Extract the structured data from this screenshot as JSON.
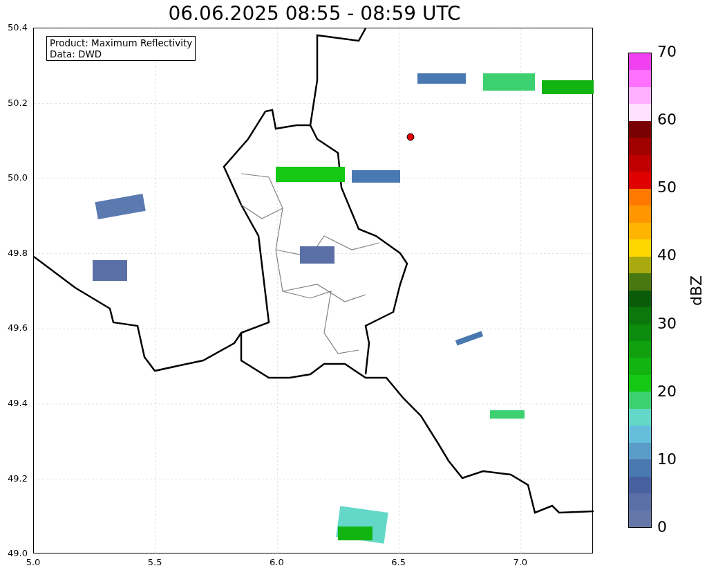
{
  "title": "06.06.2025 08:55 - 08:59 UTC",
  "info_box": [
    "Product: Maximum Reflectivity",
    "Data: DWD"
  ],
  "x_ticks": [
    "5.0",
    "5.5",
    "6.0",
    "6.5",
    "7.0"
  ],
  "y_ticks": [
    "50.4",
    "50.2",
    "50.0",
    "49.8",
    "49.6",
    "49.4",
    "49.2",
    "49.0"
  ],
  "colorbar": {
    "label": "dBZ",
    "ticks": [
      "70",
      "60",
      "50",
      "40",
      "30",
      "20",
      "10",
      "0"
    ],
    "segments": [
      {
        "color": "#f040f0"
      },
      {
        "color": "#ff70ff"
      },
      {
        "color": "#ffb0ff"
      },
      {
        "color": "#ffe0ff"
      },
      {
        "color": "#780000"
      },
      {
        "color": "#a00000"
      },
      {
        "color": "#c00000"
      },
      {
        "color": "#e00000"
      },
      {
        "color": "#ff7800"
      },
      {
        "color": "#ff9600"
      },
      {
        "color": "#ffb400"
      },
      {
        "color": "#ffd700"
      },
      {
        "color": "#aaaa10"
      },
      {
        "color": "#4a7810"
      },
      {
        "color": "#0a5c0a"
      },
      {
        "color": "#0a780a"
      },
      {
        "color": "#0c8c0c"
      },
      {
        "color": "#10a010"
      },
      {
        "color": "#12b412"
      },
      {
        "color": "#14c814"
      },
      {
        "color": "#3cd070"
      },
      {
        "color": "#64d8c8"
      },
      {
        "color": "#64bedc"
      },
      {
        "color": "#5a9cc8"
      },
      {
        "color": "#4a78b0"
      },
      {
        "color": "#4660a0"
      },
      {
        "color": "#5a6fa6"
      },
      {
        "color": "#6577a8"
      }
    ]
  }
}
